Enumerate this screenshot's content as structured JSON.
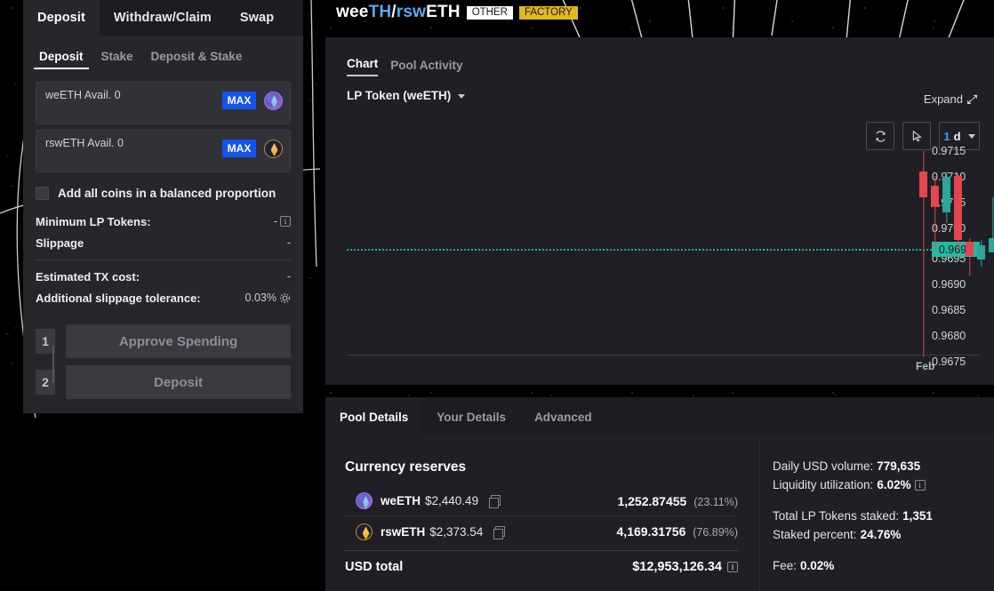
{
  "deposit_panel": {
    "tabs": [
      {
        "label": "Deposit",
        "active": true
      },
      {
        "label": "Withdraw/Claim",
        "active": false
      },
      {
        "label": "Swap",
        "active": false
      }
    ],
    "subtabs": [
      {
        "label": "Deposit",
        "active": true
      },
      {
        "label": "Stake",
        "active": false
      },
      {
        "label": "Deposit & Stake",
        "active": false
      }
    ],
    "token_inputs": [
      {
        "avail_label": "weETH Avail. 0",
        "max_label": "MAX",
        "icon": "weeth-token-icon",
        "value": "",
        "placeholder": ""
      },
      {
        "avail_label": "rswETH Avail. 0",
        "max_label": "MAX",
        "icon": "rsweth-token-icon",
        "value": "",
        "placeholder": ""
      }
    ],
    "balanced_checkbox": {
      "label": "Add all coins in a balanced proportion",
      "checked": false
    },
    "rows": [
      {
        "key": "Minimum LP Tokens:",
        "value": "-",
        "info": true
      },
      {
        "key": "Slippage",
        "value": "-",
        "info": false
      },
      {
        "key": "Estimated TX cost:",
        "value": "-",
        "info": false
      },
      {
        "key": "Additional slippage tolerance:",
        "value": "0.03%",
        "gear": true
      }
    ],
    "steps": [
      {
        "num": "1",
        "label": "Approve Spending"
      },
      {
        "num": "2",
        "label": "Deposit"
      }
    ]
  },
  "header": {
    "pair_prefix": "wee",
    "pair_mid1": "TH",
    "pair_slash": "/",
    "pair_mid2": "rsw",
    "pair_suffix": "ETH",
    "full_title": "weeTH/rswETH",
    "badges": [
      {
        "label": "OTHER",
        "kind": "other"
      },
      {
        "label": "FACTORY",
        "kind": "factory"
      }
    ]
  },
  "chart_card": {
    "tabs": [
      {
        "label": "Chart",
        "active": true
      },
      {
        "label": "Pool Activity",
        "active": false
      }
    ],
    "lp_select": "LP Token (weETH)",
    "expand_label": "Expand",
    "controls": [
      {
        "name": "refresh-icon",
        "label": ""
      },
      {
        "name": "cursor-icon",
        "label": ""
      }
    ],
    "interval": {
      "num": "1",
      "unit": "d"
    }
  },
  "chart_data": {
    "type": "candlestick",
    "title": "LP Token (weETH)",
    "xlabel": "",
    "ylabel": "",
    "ylim": [
      0.96725,
      0.97175
    ],
    "y_ticks": [
      "0.9715",
      "0.9710",
      "0.9705",
      "0.9700",
      "0.9695",
      "0.9690",
      "0.9685",
      "0.9680",
      "0.9675"
    ],
    "x_ticks": [
      "Feb"
    ],
    "grid": false,
    "interval": "1d",
    "current_price": "0.9698",
    "current_price_value": 0.9698,
    "up_color": "#2aa69a",
    "down_color": "#e4454f",
    "candles": [
      {
        "open": 0.97055,
        "high": 0.97105,
        "low": 0.96745,
        "close": 0.97005,
        "dir": "down"
      },
      {
        "open": 0.97015,
        "high": 0.97055,
        "low": 0.96945,
        "close": 0.96985,
        "dir": "down"
      },
      {
        "open": 0.96985,
        "high": 0.97065,
        "low": 0.96965,
        "close": 0.97045,
        "dir": "up"
      },
      {
        "open": 0.97055,
        "high": 0.97065,
        "low": 0.96955,
        "close": 0.96965,
        "dir": "down"
      },
      {
        "open": 0.96965,
        "high": 0.96975,
        "low": 0.96925,
        "close": 0.96945,
        "dir": "down"
      },
      {
        "open": 0.96945,
        "high": 0.96975,
        "low": 0.96935,
        "close": 0.96965,
        "dir": "up"
      },
      {
        "open": 0.96965,
        "high": 0.97055,
        "low": 0.96965,
        "close": 0.96985,
        "dir": "up"
      }
    ]
  },
  "details_card": {
    "tabs": [
      {
        "label": "Pool Details",
        "active": true
      },
      {
        "label": "Your Details",
        "active": false
      },
      {
        "label": "Advanced",
        "active": false
      }
    ],
    "reserves_title": "Currency reserves",
    "reserves": [
      {
        "name": "weETH",
        "price": "$2,440.49",
        "amount": "1,252.87455",
        "pct": "(23.11%)",
        "icon": "weeth-token-icon"
      },
      {
        "name": "rswETH",
        "price": "$2,373.54",
        "amount": "4,169.31756",
        "pct": "(76.89%)",
        "icon": "rsweth-token-icon"
      }
    ],
    "usd_total_label": "USD total",
    "usd_total_value": "$12,953,126.34",
    "stats": [
      {
        "label": "Daily USD volume:",
        "value": "779,635",
        "info": false
      },
      {
        "label": "Liquidity utilization:",
        "value": "6.02%",
        "info": true
      },
      {
        "gap": true
      },
      {
        "label": "Total LP Tokens staked:",
        "value": "1,351",
        "info": false
      },
      {
        "label": "Staked percent:",
        "value": "24.76%",
        "info": false
      },
      {
        "gap": true
      },
      {
        "label": "Fee:",
        "value": "0.02%",
        "info": false
      }
    ]
  },
  "colors": {
    "accent_blue": "#1652f0",
    "teal": "#2aa69a",
    "red": "#e4454f",
    "gold": "#e3b81c",
    "panel": "#26262b",
    "card": "#1f1f25"
  }
}
